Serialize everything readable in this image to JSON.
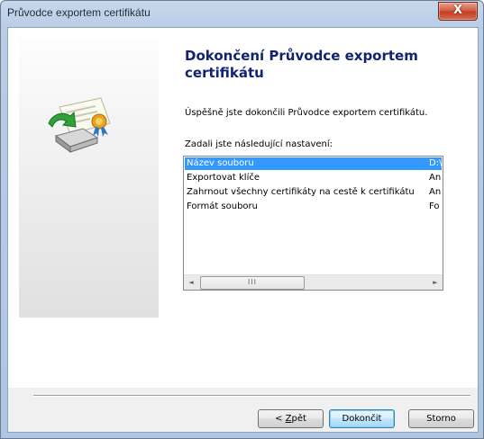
{
  "window": {
    "title": "Průvodce exportem certifikátu",
    "close_glyph": "X"
  },
  "main": {
    "heading": "Dokončení Průvodce exportem certifikátu",
    "success_text": "Úspěšně jste dokončili Průvodce exportem certifikátu.",
    "settings_label": "Zadali jste následující nastavení:",
    "icon": "certificate-export-icon"
  },
  "settings_list": {
    "rows": [
      {
        "name": "Název souboru",
        "value": "D:\\",
        "selected": true
      },
      {
        "name": "Exportovat klíče",
        "value": "An",
        "selected": false
      },
      {
        "name": "Zahrnout všechny certifikáty na cestě k certifikátu",
        "value": "An",
        "selected": false
      },
      {
        "name": "Formát souboru",
        "value": "Fo",
        "selected": false
      }
    ],
    "scroll_left_glyph": "◄",
    "scroll_right_glyph": "►",
    "thumb_grip": "III"
  },
  "buttons": {
    "back_prefix": "< ",
    "back_accel": "Z",
    "back_rest": "pět",
    "finish": "Dokončit",
    "cancel": "Storno"
  },
  "colors": {
    "heading": "#12236f",
    "selection": "#3399ff",
    "close_button": "#c03c21"
  }
}
